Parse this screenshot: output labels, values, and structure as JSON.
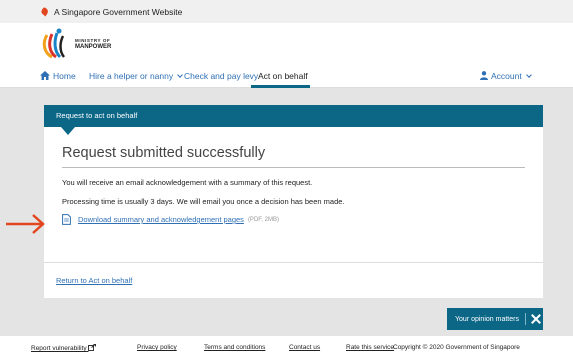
{
  "gov_bar": {
    "text": "A Singapore Government Website",
    "lion_icon": "singapore-lion-icon"
  },
  "logo": {
    "line1": "MINISTRY OF",
    "line2": "MANPOWER"
  },
  "nav": {
    "home": "Home",
    "hire": "Hire a helper or nanny",
    "levy": "Check and pay levy",
    "behalf": "Act on behalf",
    "account": "Account"
  },
  "card": {
    "header": "Request to act on behalf",
    "title": "Request submitted successfully",
    "para1": "You will receive an email acknowledgement with a summary of this request.",
    "para2": "Processing time is usually 3 days. We will email you once a decision has been made.",
    "download_label": "Download summary and acknowledgement pages",
    "download_meta": "(PDF, 2MB)",
    "return_link": "Return to Act on behalf"
  },
  "opinion": {
    "label": "Your opinion matters"
  },
  "footer": {
    "vuln": "Report vulnerability",
    "privacy": "Privacy policy",
    "terms": "Terms and conditions",
    "contact": "Contact us",
    "rate": "Rate this service",
    "copyright": "Copyright © 2020 Government of Singapore"
  },
  "colors": {
    "brand": "#0c6787",
    "link": "#2f70b5",
    "annotation_arrow": "#e2461f"
  }
}
